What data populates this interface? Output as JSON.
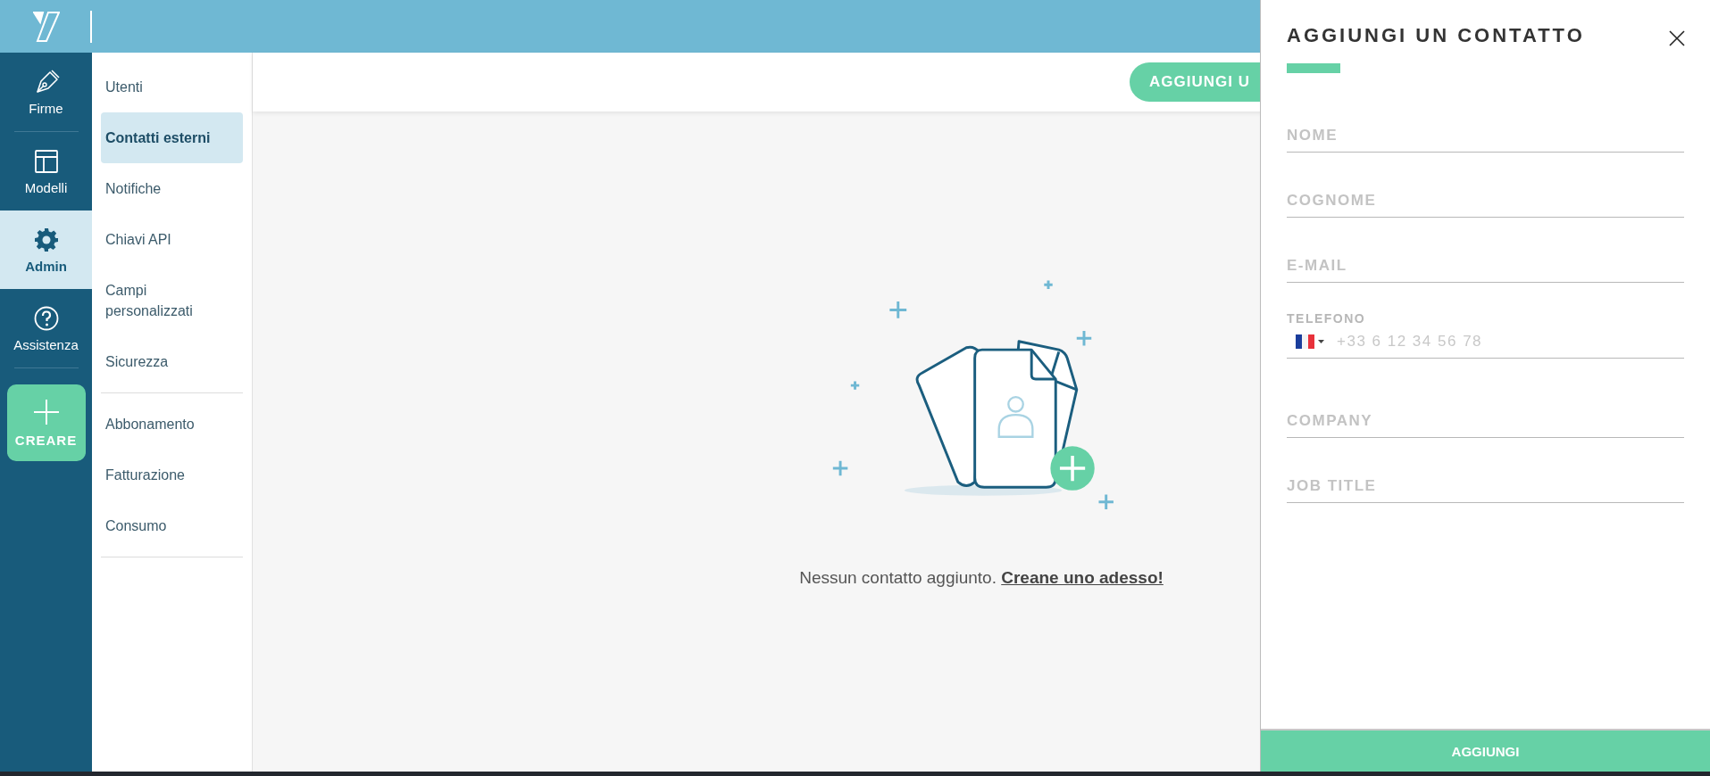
{
  "rail": {
    "items": [
      {
        "kind": "pen",
        "label": "Firme",
        "selected": false
      },
      {
        "kind": "layout",
        "label": "Modelli",
        "selected": false
      },
      {
        "kind": "gear",
        "label": "Admin",
        "selected": true
      },
      {
        "kind": "help",
        "label": "Assistenza",
        "selected": false
      }
    ],
    "create_button": {
      "label": "CREARE"
    }
  },
  "submenu": {
    "groups": [
      {
        "items": [
          {
            "label": "Utenti",
            "selected": false
          },
          {
            "label": "Contatti esterni",
            "selected": true
          },
          {
            "label": "Notifiche",
            "selected": false
          },
          {
            "label": "Chiavi API",
            "selected": false
          },
          {
            "label": "Campi personalizzati",
            "selected": false
          },
          {
            "label": "Sicurezza",
            "selected": false
          }
        ]
      },
      {
        "items": [
          {
            "label": "Abbonamento",
            "selected": false
          },
          {
            "label": "Fatturazione",
            "selected": false
          },
          {
            "label": "Consumo",
            "selected": false
          }
        ]
      }
    ]
  },
  "toolbar": {
    "add_button": "AGGIUNGI U"
  },
  "empty_state": {
    "message": "Nessun contatto aggiunto.",
    "link": "Creane uno adesso!"
  },
  "panel": {
    "title": "AGGIUNGI UN CONTATTO",
    "fields": [
      {
        "kind": "text",
        "placeholder": "NOME"
      },
      {
        "kind": "text",
        "placeholder": "COGNOME"
      },
      {
        "kind": "text",
        "placeholder": "E-MAIL"
      },
      {
        "kind": "phone",
        "label": "TELEFONO",
        "placeholder": "+33 6 12 34 56 78"
      },
      {
        "kind": "text",
        "placeholder": "COMPANY"
      },
      {
        "kind": "text",
        "placeholder": "JOB TITLE"
      }
    ],
    "submit": "AGGIUNGI"
  }
}
